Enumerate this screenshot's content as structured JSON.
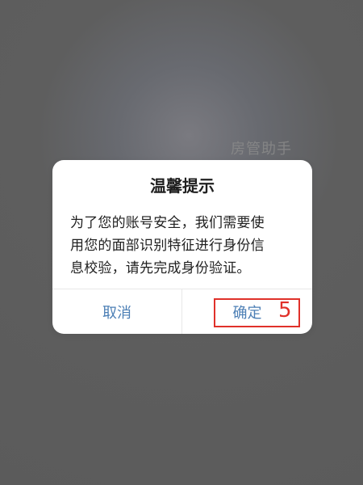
{
  "background": {
    "watermark_text": "房管助手"
  },
  "dialog": {
    "title": "温馨提示",
    "message_lines": [
      "为了您的账号安全，我们需要使",
      "用您的面部识别特征进行身份信",
      "息校验，请先完成身份验证。"
    ],
    "actions": {
      "cancel_label": "取消",
      "confirm_label": "确定"
    }
  },
  "annotation": {
    "step_number": "5",
    "highlight_color": "#e0312a"
  },
  "colors": {
    "overlay": "#5f5f5f",
    "dialog_background": "#ffffff",
    "link_blue": "#4c7fb5",
    "title_text": "#202020"
  }
}
